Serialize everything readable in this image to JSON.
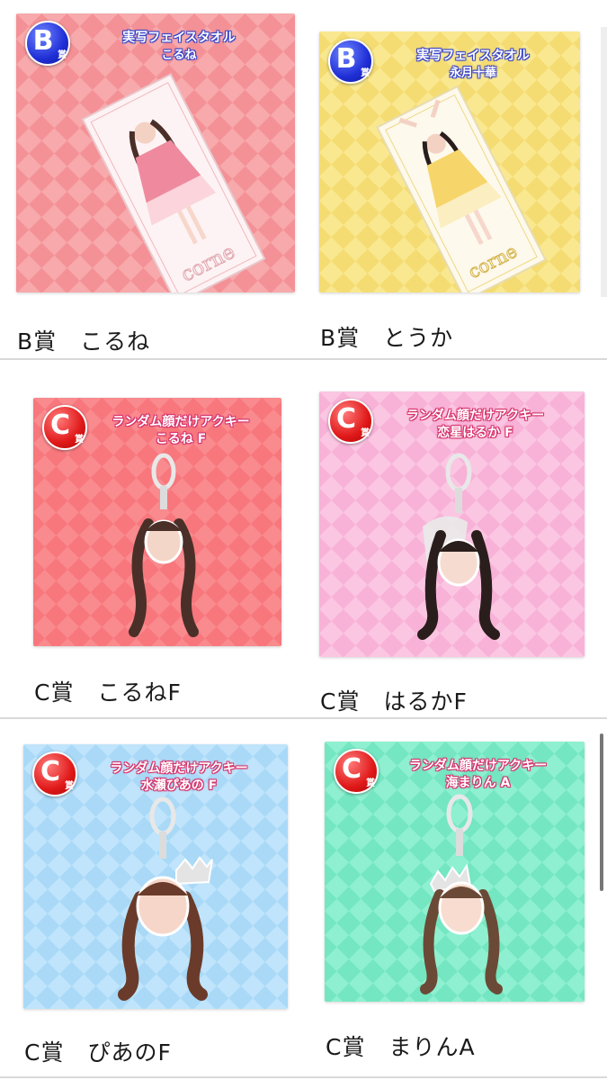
{
  "products": [
    {
      "badge_letter": "B",
      "badge_suffix": "賞",
      "title_line1": "実写フェイスタオル",
      "title_line2": "こるね",
      "caption": "B賞　こるね",
      "bg": "#f7a9ab",
      "bg_alt": "#f28f93",
      "badge_color": "blue"
    },
    {
      "badge_letter": "B",
      "badge_suffix": "賞",
      "title_line1": "実写フェイスタオル",
      "title_line2": "永月十華",
      "caption": "B賞　とうか",
      "bg": "#f9e88f",
      "bg_alt": "#f2da6f",
      "badge_color": "blue"
    },
    {
      "badge_letter": "C",
      "badge_suffix": "賞",
      "title_line1": "ランダム顔だけアクキー",
      "title_line2": "こるね F",
      "caption": "C賞　こるねF",
      "bg": "#f98a8e",
      "bg_alt": "#f26e74",
      "badge_color": "red"
    },
    {
      "badge_letter": "C",
      "badge_suffix": "賞",
      "title_line1": "ランダム顔だけアクキー",
      "title_line2": "恋星はるか F",
      "caption": "C賞　はるかF",
      "bg": "#fbc6e2",
      "bg_alt": "#f6aed6",
      "badge_color": "red"
    },
    {
      "badge_letter": "C",
      "badge_suffix": "賞",
      "title_line1": "ランダム顔だけアクキー",
      "title_line2": "水瀬ぴあの F",
      "caption": "C賞　ぴあのF",
      "bg": "#bfe4fb",
      "bg_alt": "#a6d6f6",
      "badge_color": "red"
    },
    {
      "badge_letter": "C",
      "badge_suffix": "賞",
      "title_line1": "ランダム顔だけアクキー",
      "title_line2": "海まりん A",
      "caption": "C賞　まりんA",
      "bg": "#8ef0d0",
      "bg_alt": "#6fe6c0",
      "badge_color": "red"
    }
  ],
  "towel_logo": "corne"
}
